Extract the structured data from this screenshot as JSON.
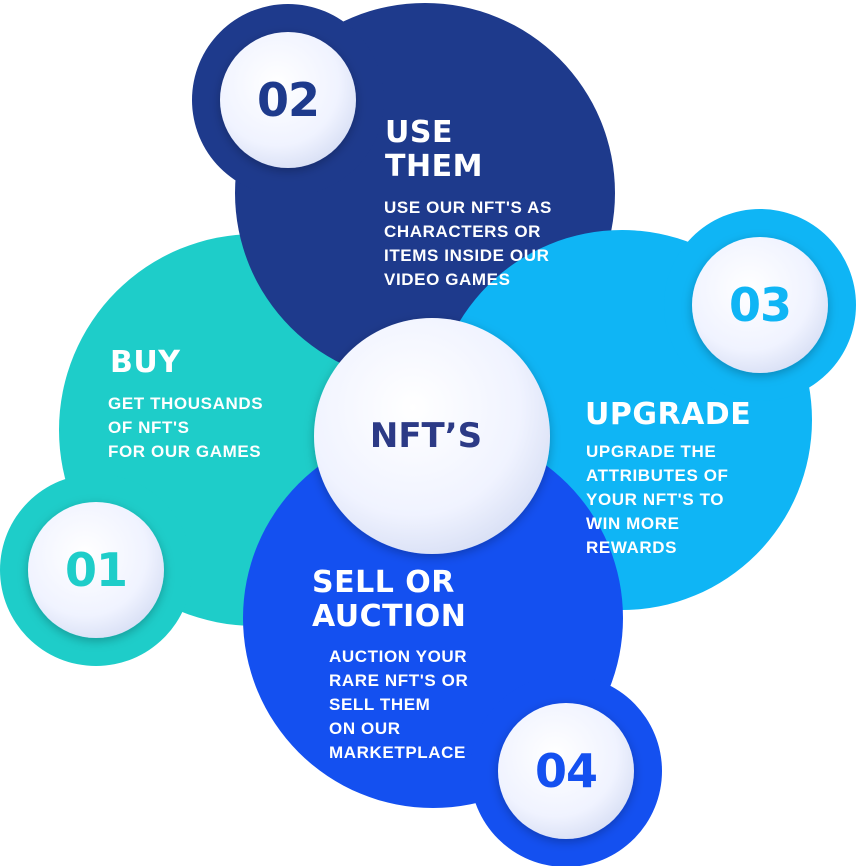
{
  "colors": {
    "teal": "#1ecdc9",
    "navy": "#1e3a8c",
    "sky": "#0fb5f5",
    "blue": "#1450f0",
    "badge_fill": "#f1f4ff",
    "center_text": "#2c3a86"
  },
  "center": {
    "label": "NFT’S"
  },
  "steps": [
    {
      "number": "01",
      "title": "BUY",
      "description": "GET THOUSANDS\nOF NFT'S\nFOR OUR GAMES"
    },
    {
      "number": "02",
      "title": "USE\nTHEM",
      "description": "USE OUR NFT'S AS\nCHARACTERS OR\nITEMS INSIDE OUR\nVIDEO GAMES"
    },
    {
      "number": "03",
      "title": "UPGRADE",
      "description": "UPGRADE THE\nATTRIBUTES OF\nYOUR NFT'S TO\nWIN MORE\nREWARDS"
    },
    {
      "number": "04",
      "title": "SELL OR\nAUCTION",
      "description": "AUCTION YOUR\nRARE NFT'S OR\nSELL THEM\nON OUR\nMARKETPLACE"
    }
  ]
}
